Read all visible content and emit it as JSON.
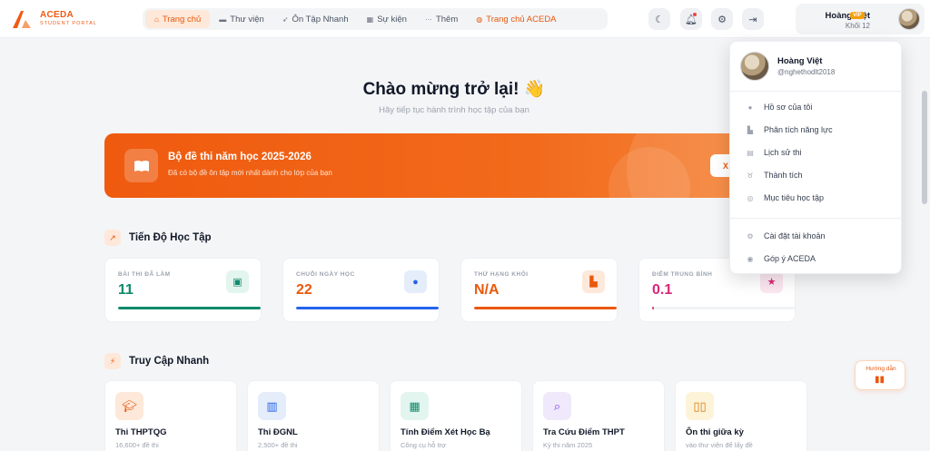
{
  "brand": {
    "title": "ACEDA",
    "subtitle": "STUDENT PORTAL",
    "accent": "#f05a14"
  },
  "nav": [
    {
      "label": "Trang chủ",
      "icon": "home-icon",
      "active": true
    },
    {
      "label": "Thư viện",
      "icon": "library-icon"
    },
    {
      "label": "Ôn Tập Nhanh",
      "icon": "bolt-icon"
    },
    {
      "label": "Sự kiện",
      "icon": "calendar-icon"
    },
    {
      "label": "Thêm",
      "icon": "more-icon"
    },
    {
      "label": "Trang chủ ACEDA",
      "icon": "globe-icon"
    }
  ],
  "header_buttons": [
    "moon-icon",
    "bell-icon",
    "gear-icon",
    "logout-icon"
  ],
  "user": {
    "name": "Hoàng Việt",
    "badge": "VIP",
    "grade": "Khối 12",
    "handle": "@nghethodlt2018"
  },
  "welcome": {
    "title": "Chào mừng trở lại! 👋",
    "subtitle": "Hãy tiếp tục hành trình học tập của bạn"
  },
  "banner": {
    "title": "Bộ đề thi năm học 2025-2026",
    "desc": "Đã có bộ đề ôn tập mới nhất dành cho lớp của bạn",
    "button": "X"
  },
  "progress": {
    "title": "Tiến Độ Học Tập",
    "stats": [
      {
        "label": "BÀI THI ĐÃ LÀM",
        "value": "11",
        "color": "#0f8a6b",
        "icon_bg": "#e3f5ef",
        "icon": "file-check-icon",
        "fill": 1.0
      },
      {
        "label": "CHUỖI NGÀY HỌC",
        "value": "22",
        "color": "#ea580c",
        "bar_color": "#2563eb",
        "icon_bg": "#e5edfb",
        "icon": "flame-icon",
        "fill": 1.0
      },
      {
        "label": "THỨ HẠNG KHỐI",
        "value": "N/A",
        "color": "#ea580c",
        "icon_bg": "#fde8d9",
        "icon": "podium-icon",
        "fill": 1.0
      },
      {
        "label": "ĐIỂM TRUNG BÌNH",
        "value": "0.1",
        "color": "#db2777",
        "icon_bg": "#fce7f0",
        "icon": "star-icon",
        "fill": 0.01
      }
    ]
  },
  "quick": {
    "title": "Truy Cập Nhanh",
    "items": [
      {
        "title": "Thi THPTQG",
        "sub": "16,600+ đề thi",
        "icon": "graduation-cap-icon",
        "bg": "#fde8d9",
        "fg": "#ea580c"
      },
      {
        "title": "Thi ĐGNL",
        "sub": "2,500+ đề thi",
        "icon": "building-icon",
        "bg": "#e5edfb",
        "fg": "#2563eb"
      },
      {
        "title": "Tính Điểm Xét Học Bạ",
        "sub": "Công cụ hỗ trợ",
        "icon": "calculator-icon",
        "bg": "#e3f5ef",
        "fg": "#0f8a6b"
      },
      {
        "title": "Tra Cứu Điểm THPT",
        "sub": "Kỳ thi năm 2025",
        "icon": "search-icon",
        "bg": "#efe9fb",
        "fg": "#7c3aed"
      },
      {
        "title": "Ôn thi giữa kỳ",
        "sub": "vào thư viện để lấy đề",
        "icon": "book-open-icon",
        "bg": "#fdf3d8",
        "fg": "#d97706"
      }
    ]
  },
  "menu": [
    {
      "label": "Hồ sơ của tôi",
      "icon": "user-icon"
    },
    {
      "label": "Phân tích năng lực",
      "icon": "chart-icon"
    },
    {
      "label": "Lịch sử thi",
      "icon": "history-icon"
    },
    {
      "label": "Thành tích",
      "icon": "medal-icon"
    },
    {
      "label": "Mục tiêu học tập",
      "icon": "target-icon"
    },
    {
      "label": "Cài đặt tài khoản",
      "icon": "gear-icon"
    },
    {
      "label": "Góp ý ACEDA",
      "icon": "chat-icon"
    }
  ],
  "guide": {
    "label": "Hướng dẫn",
    "icon": "book-icon"
  }
}
